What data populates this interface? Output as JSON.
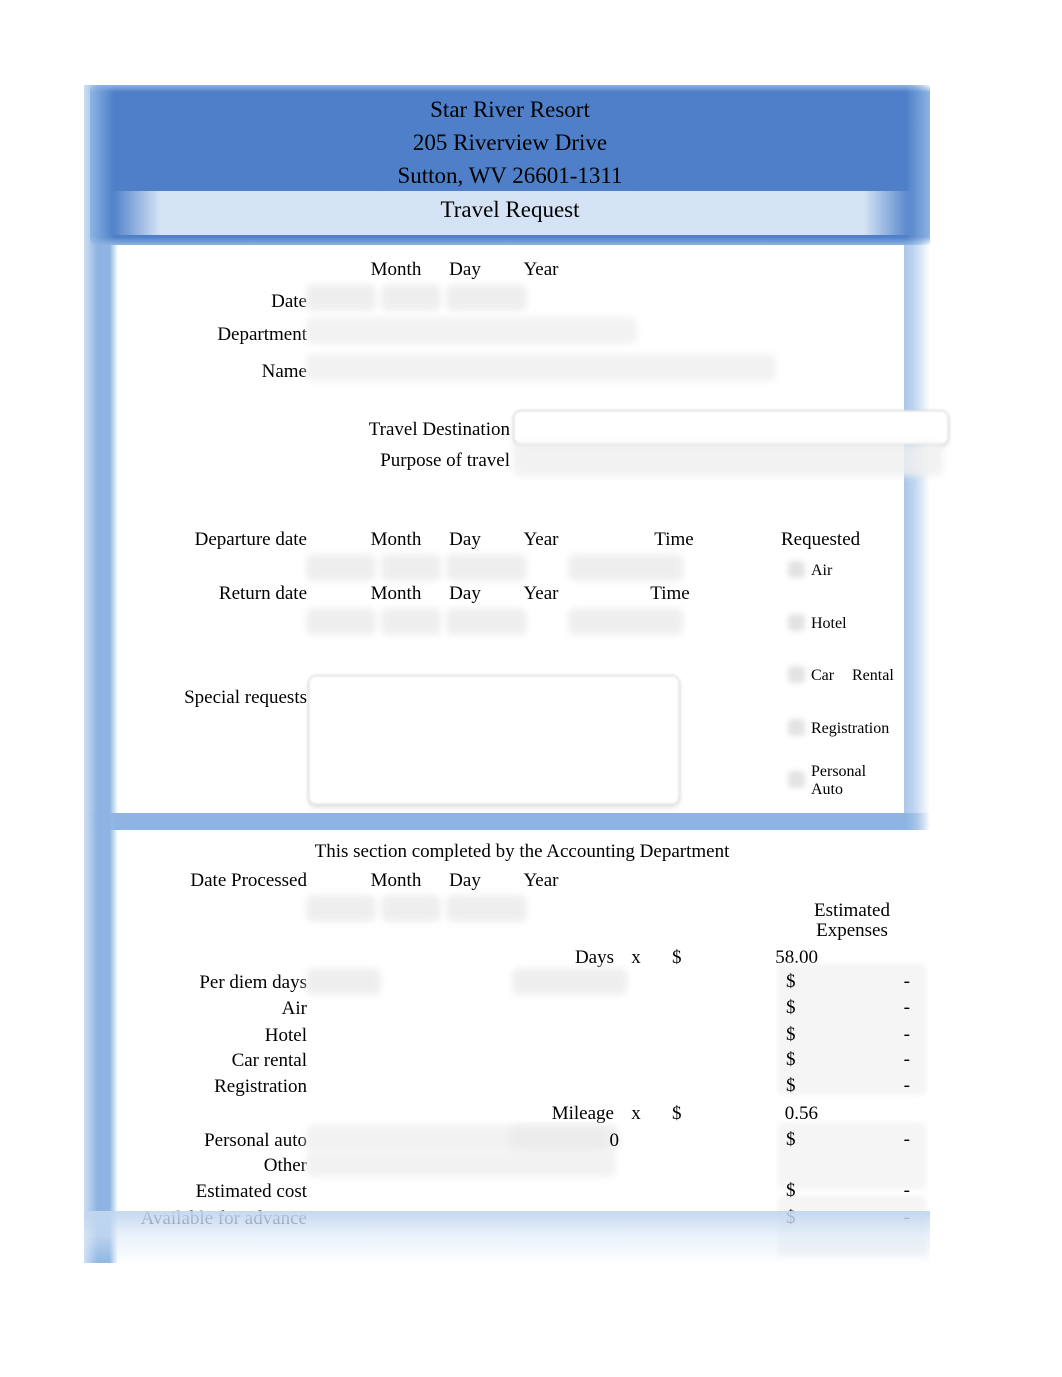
{
  "header": {
    "company": "Star River Resort",
    "street": "205 Riverview Drive",
    "citystatezip": "Sutton, WV 26601-1311",
    "form_title": "Travel Request",
    "band_color": "#8DB4E2",
    "light_band_color": "#DBE8F7"
  },
  "date_header": {
    "month": "Month",
    "day": "Day",
    "year": "Year"
  },
  "top_fields": {
    "date_label": "Date",
    "date_month_value": "",
    "date_day_value": "",
    "date_year_value": "",
    "department_label": "Department",
    "department_value": "",
    "name_label": "Name",
    "name_value": ""
  },
  "trip": {
    "destination_label": "Travel Destination",
    "destination_value": "",
    "purpose_label": "Purpose of travel",
    "purpose_value": ""
  },
  "schedule": {
    "departure_label": "Departure date",
    "return_label": "Return date",
    "month": "Month",
    "day": "Day",
    "year": "Year",
    "time": "Time",
    "departure_month_value": "",
    "departure_day_value": "",
    "departure_year_value": "",
    "departure_time_value": "",
    "return_month_value": "",
    "return_day_value": "",
    "return_year_value": "",
    "return_time_value": ""
  },
  "requested": {
    "title": "Requested",
    "items": [
      {
        "label": "Air",
        "checked": false
      },
      {
        "label": "Hotel",
        "checked": false
      },
      {
        "label": "Car",
        "label2": "Rental",
        "checked": false
      },
      {
        "label": "Registration",
        "checked": false
      },
      {
        "label": "Personal",
        "label2": "Auto",
        "checked": false
      }
    ]
  },
  "special": {
    "label": "Special requests",
    "value": ""
  },
  "accounting": {
    "section_title": "This section completed by the Accounting Department",
    "date_processed_label": "Date Processed",
    "month": "Month",
    "day": "Day",
    "year": "Year",
    "processed_month_value": "",
    "processed_day_value": "",
    "processed_year_value": "",
    "estimated_expenses_line1": "Estimated",
    "estimated_expenses_line2": "Expenses",
    "days_label": "Days",
    "times_symbol": "x",
    "dollar_symbol": "$",
    "per_diem_rate": "58.00",
    "mileage_label": "Mileage",
    "mileage_rate": "0.56",
    "mileage_value": "0",
    "rows": [
      {
        "label": "Per diem days",
        "input": "",
        "dollar": "$",
        "amount": "-"
      },
      {
        "label": "Air",
        "input": "",
        "dollar": "$",
        "amount": "-"
      },
      {
        "label": "Hotel",
        "input": "",
        "dollar": "$",
        "amount": "-"
      },
      {
        "label": "Car rental",
        "input": "",
        "dollar": "$",
        "amount": "-"
      },
      {
        "label": "Registration",
        "input": "",
        "dollar": "$",
        "amount": "-"
      }
    ],
    "personal_auto_label": "Personal auto",
    "personal_auto_dollar": "$",
    "personal_auto_amount": "-",
    "other_label": "Other",
    "other_value": "",
    "estimated_cost_label": "Estimated cost",
    "estimated_cost_dollar": "$",
    "estimated_cost_amount": "-",
    "advance_label": "Available for advance",
    "advance_dollar": "$",
    "advance_amount": "-"
  }
}
